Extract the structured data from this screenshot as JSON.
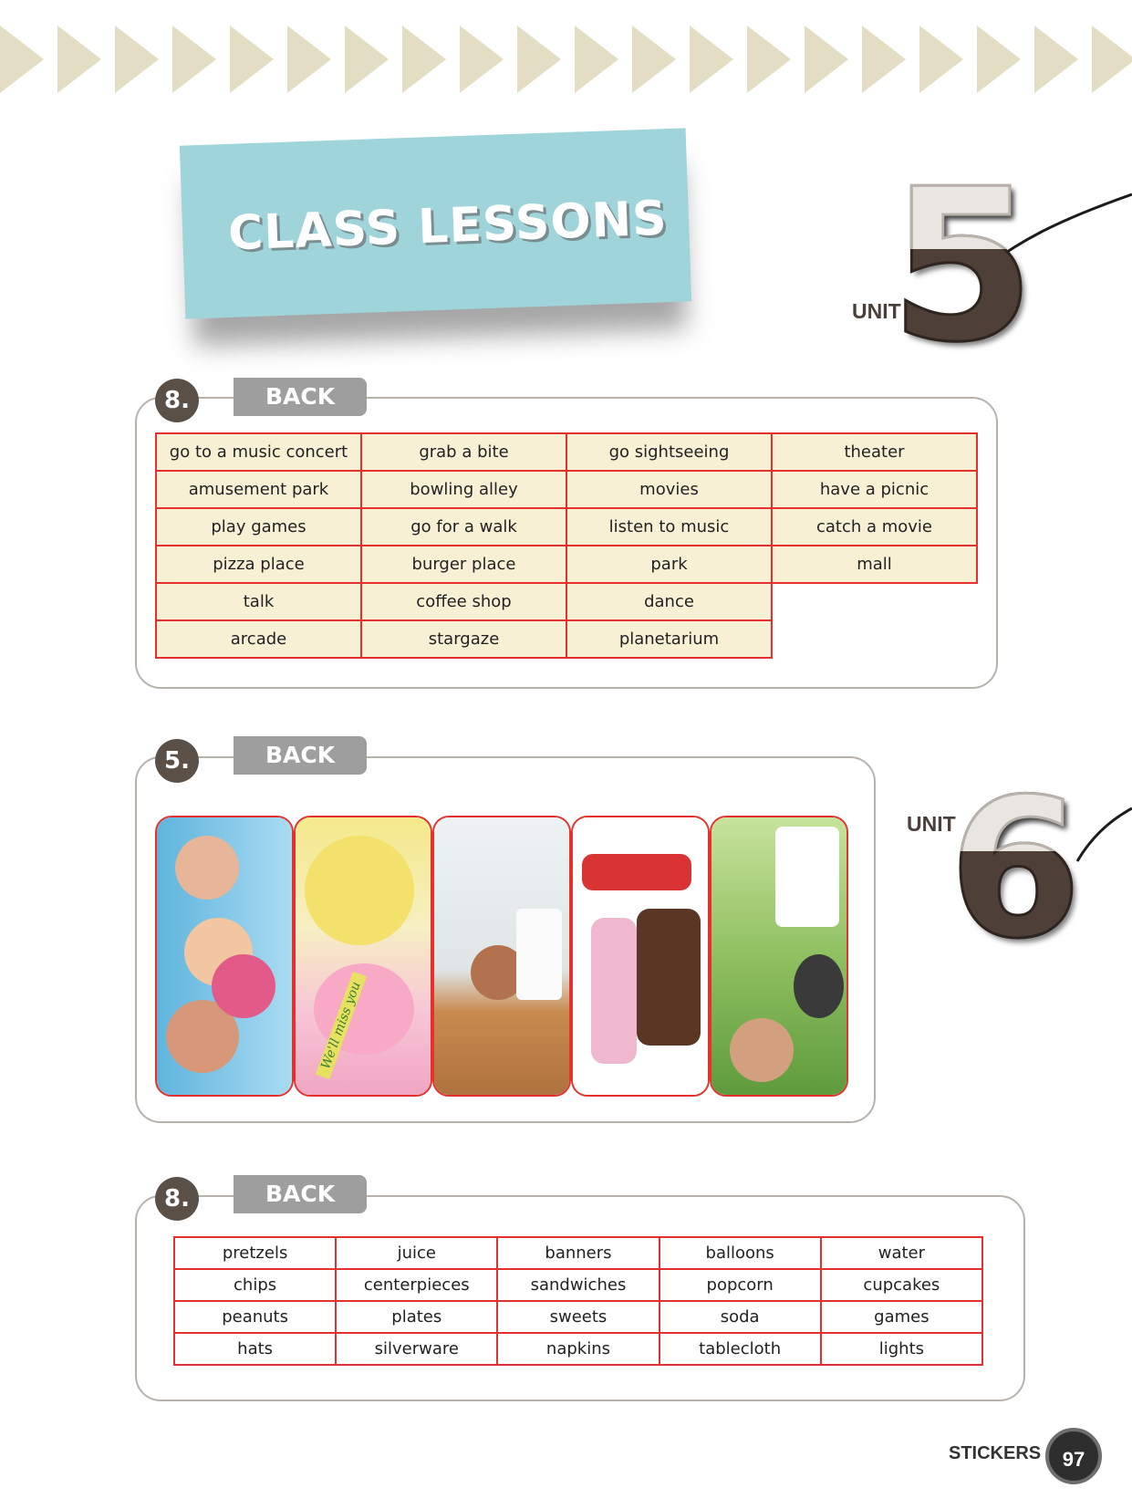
{
  "title": "CLASS LESSONS",
  "units": [
    {
      "label": "UNIT",
      "number": "5"
    },
    {
      "label": "UNIT",
      "number": "6"
    }
  ],
  "back_label": "BACK",
  "sections": [
    {
      "number": "8.",
      "rows": [
        [
          "go to a music concert",
          "grab a bite",
          "go sightseeing",
          "theater"
        ],
        [
          "amusement park",
          "bowling alley",
          "movies",
          "have a picnic"
        ],
        [
          "play games",
          "go for a walk",
          "listen to music",
          "catch a movie"
        ],
        [
          "pizza place",
          "burger place",
          "park",
          "mall"
        ],
        [
          "talk",
          "coffee shop",
          "dance"
        ],
        [
          "arcade",
          "stargaze",
          "planetarium"
        ]
      ]
    },
    {
      "number": "5.",
      "photos": [
        {
          "subject": "group of friends",
          "caption": ""
        },
        {
          "subject": "cupcake",
          "caption": "We'll miss you"
        },
        {
          "subject": "girl in room",
          "caption": ""
        },
        {
          "subject": "kids on sofa",
          "caption": ""
        },
        {
          "subject": "family picnic barbecue",
          "caption": ""
        }
      ]
    },
    {
      "number": "8.",
      "rows": [
        [
          "pretzels",
          "juice",
          "banners",
          "balloons",
          "water"
        ],
        [
          "chips",
          "centerpieces",
          "sandwiches",
          "popcorn",
          "cupcakes"
        ],
        [
          "peanuts",
          "plates",
          "sweets",
          "soda",
          "games"
        ],
        [
          "hats",
          "silverware",
          "napkins",
          "tablecloth",
          "lights"
        ]
      ]
    }
  ],
  "footer": {
    "label": "STICKERS",
    "page": "97"
  },
  "colors": {
    "tape": "#9ed4da",
    "cell_border": "#e4312e",
    "cell_fill": "#f8f0d5",
    "badge": "#5a5048",
    "tab": "#9e9e9e"
  }
}
